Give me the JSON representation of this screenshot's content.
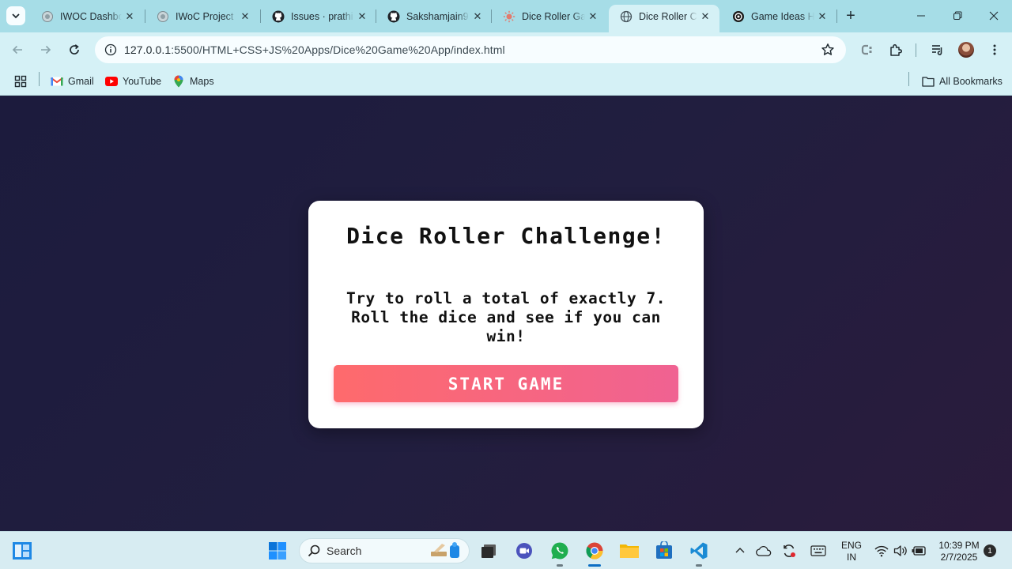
{
  "browser": {
    "tabs": [
      {
        "title": "IWOC Dashboard",
        "icon": "globe-gray-icon",
        "active": false
      },
      {
        "title": "IWoC Project",
        "icon": "globe-gray-icon",
        "active": false
      },
      {
        "title": "Issues · prathi",
        "icon": "github-icon",
        "active": false
      },
      {
        "title": "Sakshamjain9",
        "icon": "github-icon",
        "active": false
      },
      {
        "title": "Dice Roller Ga",
        "icon": "sun-icon",
        "active": false
      },
      {
        "title": "Dice Roller Ch",
        "icon": "globe-icon",
        "active": true
      },
      {
        "title": "Game Ideas H",
        "icon": "openai-icon",
        "active": false
      }
    ],
    "address": {
      "host": "127.0.0.1",
      "path": ":5500/HTML+CSS+JS%20Apps/Dice%20Game%20App/index.html"
    },
    "bookmarks": [
      {
        "label": "Gmail",
        "icon": "gmail-icon"
      },
      {
        "label": "YouTube",
        "icon": "youtube-icon"
      },
      {
        "label": "Maps",
        "icon": "maps-icon"
      }
    ],
    "all_bookmarks_label": "All Bookmarks"
  },
  "game": {
    "title": "Dice Roller Challenge!",
    "description": "Try to roll a total of exactly 7. Roll the dice and see if you can win!",
    "start_button": "START GAME"
  },
  "taskbar": {
    "search_label": "Search",
    "language": "ENG",
    "region": "IN",
    "time": "10:39 PM",
    "date": "2/7/2025",
    "notification_count": "1"
  },
  "colors": {
    "page_background": "#1f1d3a",
    "button_gradient_start": "#fe6a6c",
    "button_gradient_end": "#f06292",
    "chrome_frame": "#a6dde7",
    "chrome_toolbar": "#d5f1f6"
  }
}
